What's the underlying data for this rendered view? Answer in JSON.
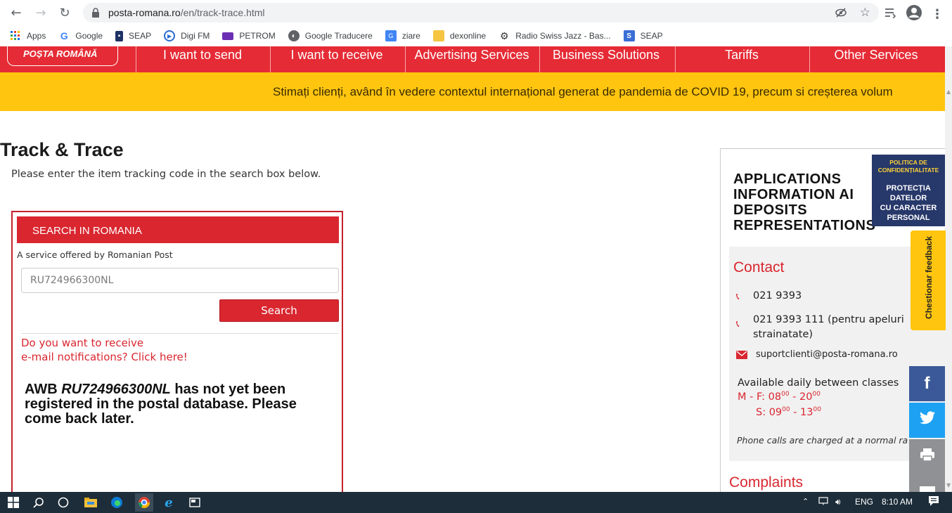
{
  "browser": {
    "url_host": "posta-romana.ro",
    "url_path": "/en/track-trace.html",
    "bookmarks": [
      "Apps",
      "Google",
      "SEAP",
      "Digi FM",
      "PETROM",
      "Google Traducere",
      "ziare",
      "dexonline",
      "Radio Swiss Jazz - Bas...",
      "SEAP"
    ]
  },
  "site": {
    "logo": "POȘTA ROMÂNĂ",
    "nav": [
      "I want to send",
      "I want to receive",
      "Advertising Services",
      "Business Solutions",
      "Tariffs",
      "Other Services"
    ],
    "ticker": "Stimați clienți, având în vedere contextul internațional generat de pandemia de COVID 19, precum si creșterea volum",
    "accent": "#e52b35",
    "ticker_color": "#ffc50f"
  },
  "page": {
    "title": "Track & Trace",
    "subtitle": "Please enter the item tracking code in the search box below."
  },
  "search": {
    "header": "SEARCH IN ROMANIA",
    "service": "A service offered by Romanian Post",
    "code_value": "RU724966300NL",
    "button": "Search",
    "notify_line1": "Do you want to receive",
    "notify_line2": "e-mail notifications? Click here!",
    "result_prefix": "AWB ",
    "result_code": "RU724966300NL",
    "result_suffix": " has not yet been registered in the postal database. Please come back later."
  },
  "panel": {
    "head_lines": [
      "APPLICATIONS",
      "INFORMATION AI",
      "DEPOSITS",
      "REPRESENTATIONS"
    ],
    "contact_title": "Contact",
    "phone1": "021 9393",
    "phone2_line1": "021 9393 111 (pentru apeluri",
    "phone2_line2": "strainatate)",
    "email": "suportclienti@posta-romana.ro",
    "availability": "Available daily between classes",
    "weekday_label": "M - F: 08",
    "weekday_sup1": "00",
    "weekday_mid": " - 20",
    "weekday_sup2": "00",
    "sat_label": "S: 09",
    "sat_sup1": "00",
    "sat_mid": " - 13",
    "sat_sup2": "00",
    "charged_note": "Phone calls are charged at a normal ra",
    "complaints": "Complaints"
  },
  "badges": {
    "privacy_top1": "POLITICA DE",
    "privacy_top2": "CONFIDENȚIALITATE",
    "privacy_main1": "PROTECȚIA",
    "privacy_main2": "DATELOR",
    "privacy_main3": "CU CARACTER",
    "privacy_main4": "PERSONAL",
    "feedback": "Chestionar feedback"
  },
  "taskbar": {
    "language": "ENG",
    "time": "8:10 AM"
  }
}
